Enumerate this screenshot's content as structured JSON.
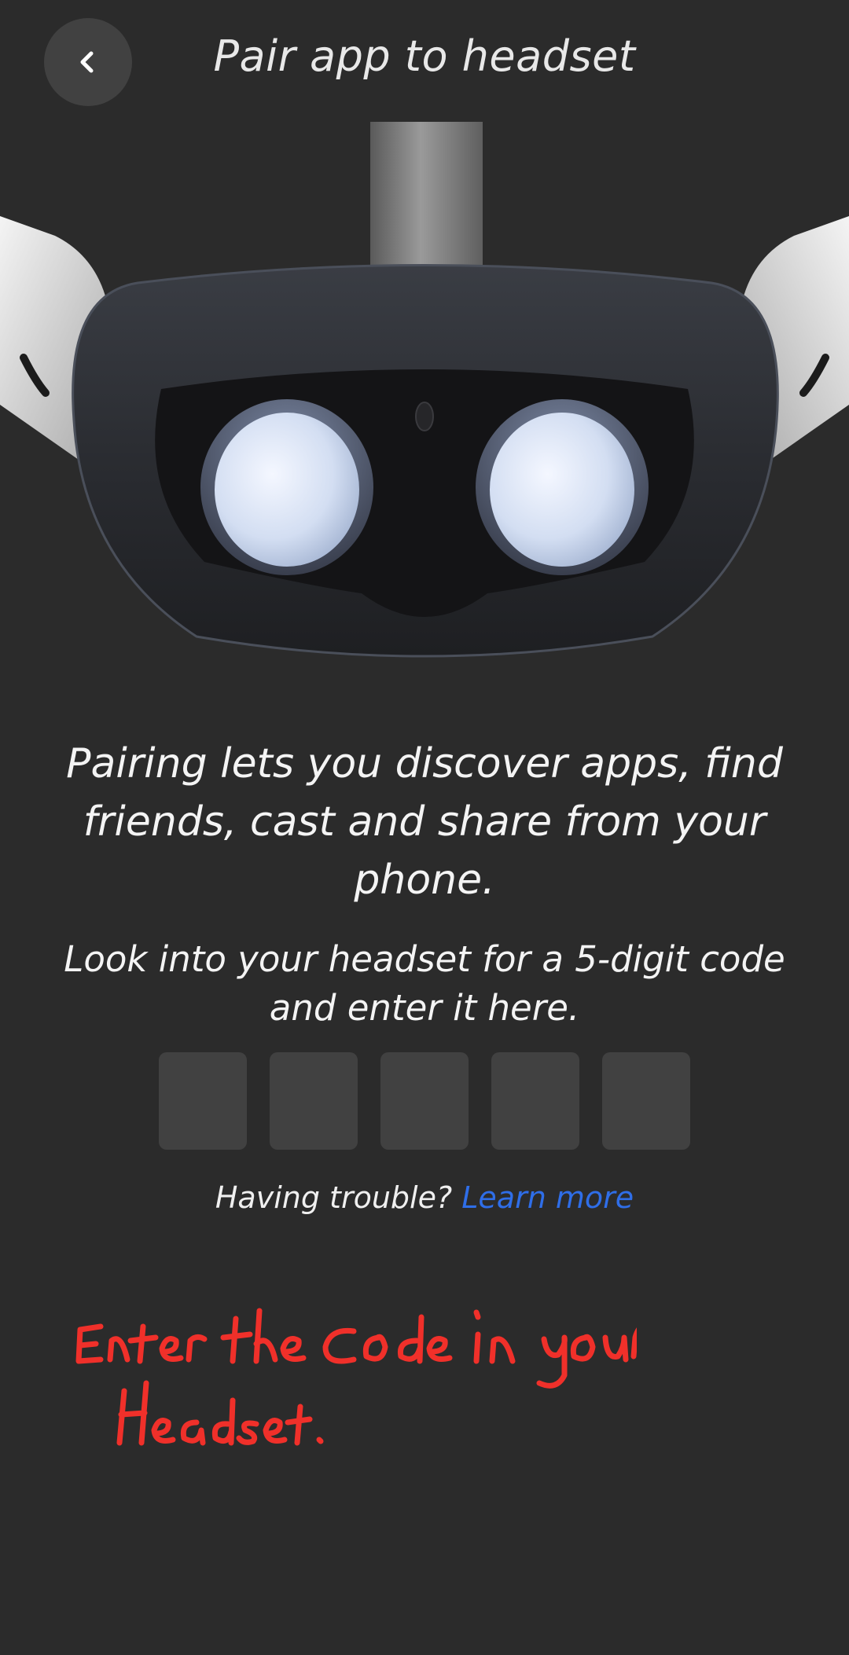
{
  "header": {
    "title": "Pair app to headset",
    "back_icon": "chevron-left-icon"
  },
  "hero": {
    "image": "vr-headset-rear-view"
  },
  "main": {
    "description": "Pairing lets you discover apps, find friends, cast and share from your phone.",
    "instruction": "Look into your headset for a 5-digit code and enter it here.",
    "code_digits": [
      "",
      "",
      "",
      "",
      ""
    ]
  },
  "help": {
    "prefix": "Having trouble?",
    "link": "Learn more"
  },
  "annotation": {
    "handwritten_note": "Enter the code in your Headset."
  },
  "colors": {
    "background": "#2b2b2b",
    "surface": "#414141",
    "link": "#2f6ee8",
    "annotation": "#f0302a"
  }
}
